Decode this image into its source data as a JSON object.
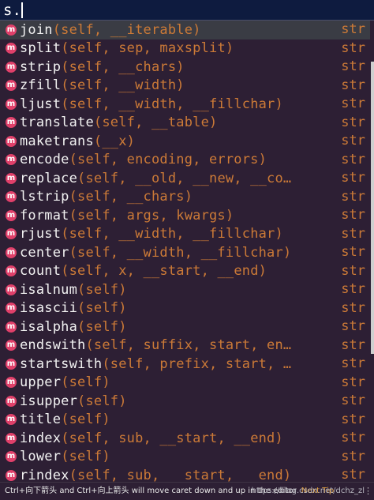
{
  "editor": {
    "text": "s."
  },
  "completion": {
    "badge_letter": "m",
    "items": [
      {
        "name": "join",
        "params": "(self, __iterable)",
        "type": "str"
      },
      {
        "name": "split",
        "params": "(self, sep, maxsplit)",
        "type": "str"
      },
      {
        "name": "strip",
        "params": "(self, __chars)",
        "type": "str"
      },
      {
        "name": "zfill",
        "params": "(self, __width)",
        "type": "str"
      },
      {
        "name": "ljust",
        "params": "(self, __width, __fillchar)",
        "type": "str"
      },
      {
        "name": "translate",
        "params": "(self, __table)",
        "type": "str"
      },
      {
        "name": "maketrans",
        "params": "(__x)",
        "type": "str"
      },
      {
        "name": "encode",
        "params": "(self, encoding, errors)",
        "type": "str"
      },
      {
        "name": "replace",
        "params": "(self, __old, __new, __co…",
        "type": "str"
      },
      {
        "name": "lstrip",
        "params": "(self, __chars)",
        "type": "str"
      },
      {
        "name": "format",
        "params": "(self, args, kwargs)",
        "type": "str"
      },
      {
        "name": "rjust",
        "params": "(self, __width, __fillchar)",
        "type": "str"
      },
      {
        "name": "center",
        "params": "(self, __width, __fillchar)",
        "type": "str"
      },
      {
        "name": "count",
        "params": "(self, x, __start, __end)",
        "type": "str"
      },
      {
        "name": "isalnum",
        "params": "(self)",
        "type": "str"
      },
      {
        "name": "isascii",
        "params": "(self)",
        "type": "str"
      },
      {
        "name": "isalpha",
        "params": "(self)",
        "type": "str"
      },
      {
        "name": "endswith",
        "params": "(self, suffix, start, en…",
        "type": "str"
      },
      {
        "name": "startswith",
        "params": "(self, prefix, start, …",
        "type": "str"
      },
      {
        "name": "upper",
        "params": "(self)",
        "type": "str"
      },
      {
        "name": "isupper",
        "params": "(self)",
        "type": "str"
      },
      {
        "name": "title",
        "params": "(self)",
        "type": "str"
      },
      {
        "name": "index",
        "params": "(self, sub, __start, __end)",
        "type": "str"
      },
      {
        "name": "lower",
        "params": "(self)",
        "type": "str"
      },
      {
        "name": "rindex",
        "params": "(self, sub, __start, __end)",
        "type": "str"
      }
    ]
  },
  "footer": {
    "hint": "Ctrl+向下箭头 and Ctrl+向上箭头 will move caret down and up in the editor",
    "next_tip": "Next Tip",
    "watermark": "https://blog.csdn.net/dchz_zl",
    "menu": "⋮"
  },
  "colors": {
    "badge": "#e0406a",
    "params": "#cc7a37",
    "selected_row": "#3a3c44",
    "background": "#2d1f34"
  }
}
